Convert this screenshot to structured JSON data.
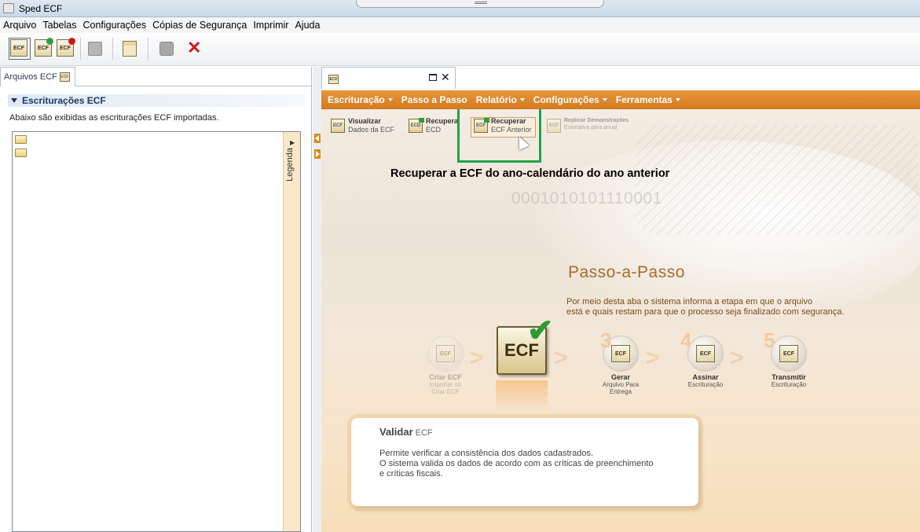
{
  "window": {
    "title": "Sped ECF"
  },
  "menubar": [
    "Arquivo",
    "Tabelas",
    "Configurações",
    "Cópias de Segurança",
    "Imprimir",
    "Ajuda"
  ],
  "toolbar": {
    "ecf_icon_text": "ECF",
    "buttons": [
      {
        "icon": "ecf-open-icon",
        "selected": true
      },
      {
        "icon": "ecf-import-icon"
      },
      {
        "icon": "ecf-delete-icon"
      },
      {
        "icon": "backup-icon"
      },
      {
        "icon": "edit-form-icon"
      },
      {
        "icon": "search-tool-icon"
      },
      {
        "icon": "exit-x-icon"
      }
    ]
  },
  "left_panel": {
    "tab_label": "Arquivos ECF",
    "tab_icon_text": "ECF",
    "section_title": "Escriturações ECF",
    "description": "Abaixo são exibidas as escriturações ECF importadas.",
    "legend_label": "Legenda",
    "tree_items": 2
  },
  "doc_tab": {
    "icon_text": "ECF"
  },
  "nav": [
    "Escrituração",
    "Passo a Passo",
    "Relatório",
    "Configurações",
    "Ferramentas"
  ],
  "actions": [
    {
      "line1": "Visualizar",
      "line2": "Dados da ECF",
      "icon_text": "ECF"
    },
    {
      "line1": "Recupera",
      "line2": "ECD",
      "icon_text": "ECD"
    },
    {
      "line1": "Recuperar",
      "line2": "ECF Anterior",
      "icon_text": "ECF"
    },
    {
      "line1": "Replicar Demonstrações",
      "line2": "Estimativa para anual",
      "icon_text": "ECF"
    }
  ],
  "annotation": "Recuperar a ECF do ano-calendário do ano anterior",
  "binary_text": "0001010101110001",
  "passo": {
    "title": "Passo-a-Passo",
    "desc_line1": "Por meio desta aba o sistema informa a etapa em que o arquivo",
    "desc_line2": "está e quais restam para que o processo seja finalizado com segurança."
  },
  "steps": [
    {
      "label": "Criar ECF",
      "sub1": "Importar ou",
      "sub2": "Criar ECF",
      "num": ""
    },
    {
      "label": "Gerar",
      "sub1": "Arquivo Para",
      "sub2": "Entrega",
      "num": "3"
    },
    {
      "label": "Assinar",
      "sub1": "Escrituração",
      "sub2": "",
      "num": "4"
    },
    {
      "label": "Transmitir",
      "sub1": "Escrituração",
      "sub2": "",
      "num": "5"
    }
  ],
  "current_step_text": "ECF",
  "info": {
    "title": "Validar",
    "title_suffix": "ECF",
    "line1": "Permite verificar a consistência dos dados cadastrados.",
    "line2": "O sistema valida os dados de acordo com as críticas de preenchimento",
    "line3": "e críticas fiscais."
  },
  "colors": {
    "accent_orange": "#e08a17",
    "highlight_green": "#1fa34a",
    "close_red": "#d01818"
  }
}
